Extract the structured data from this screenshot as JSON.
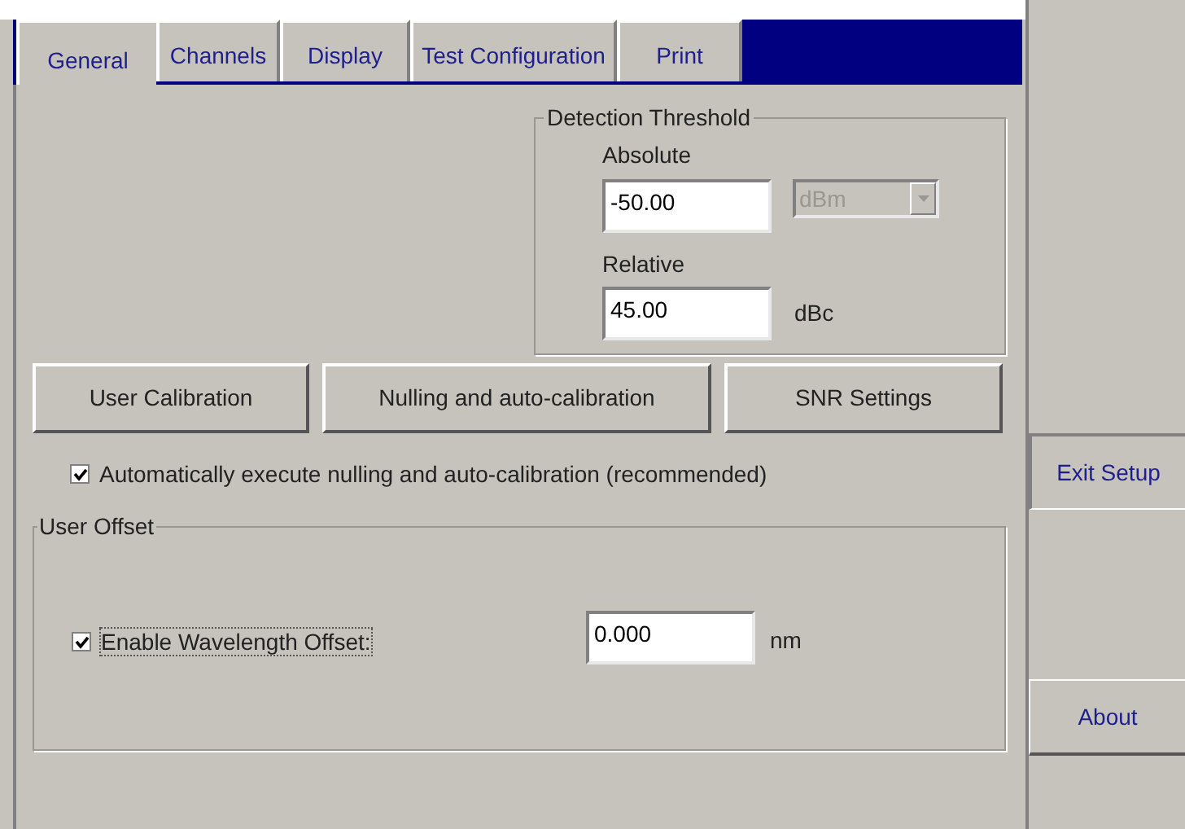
{
  "tabs": [
    {
      "label": "General",
      "selected": true
    },
    {
      "label": "Channels",
      "selected": false
    },
    {
      "label": "Display",
      "selected": false
    },
    {
      "label": "Test Configuration",
      "selected": false
    },
    {
      "label": "Print",
      "selected": false
    }
  ],
  "detection_threshold": {
    "title": "Detection Threshold",
    "absolute_label": "Absolute",
    "absolute_value": "-50.00",
    "absolute_unit": {
      "value": "dBm",
      "disabled": true
    },
    "relative_label": "Relative",
    "relative_value": "45.00",
    "relative_unit": "dBc"
  },
  "buttons": [
    "User Calibration",
    "Nulling and auto-calibration",
    "SNR Settings"
  ],
  "auto_calibrate": {
    "label": "Automatically execute nulling and auto-calibration (recommended)",
    "checked": true
  },
  "user_offset": {
    "title": "User Offset",
    "enable": {
      "label": "Enable Wavelength Offset:",
      "checked": true
    },
    "value": "0.000",
    "unit": "nm"
  },
  "side_buttons": [
    "Exit Setup",
    "About"
  ]
}
